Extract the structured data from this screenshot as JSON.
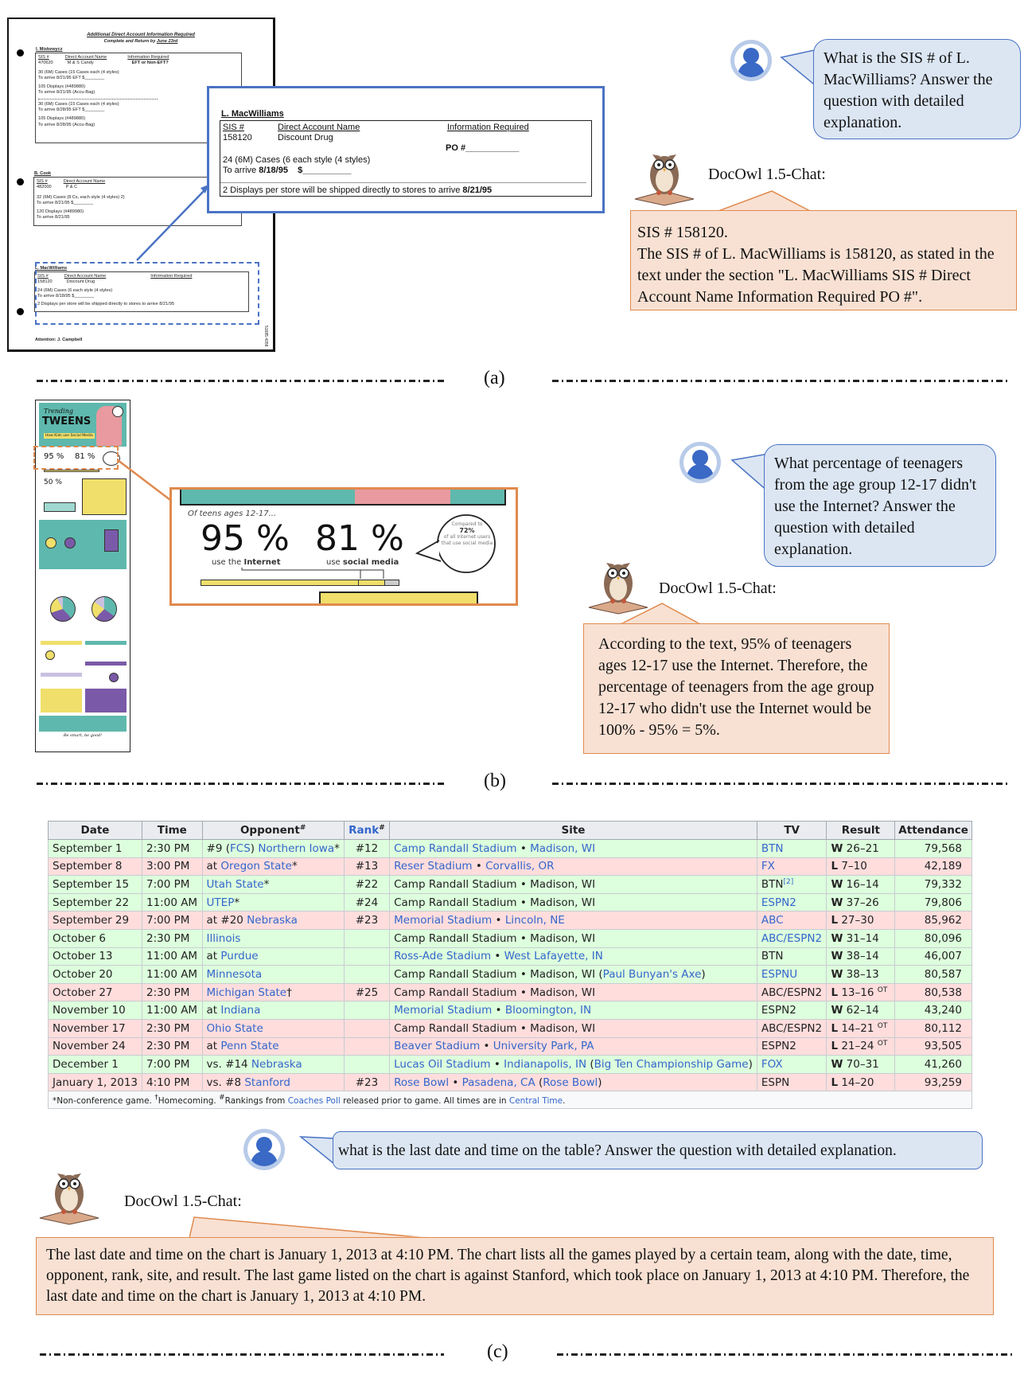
{
  "panels": {
    "a": {
      "label": "(a)",
      "document": {
        "title": "Additional Direct Account Information Required",
        "subtitle_prefix": "Complete and Return by ",
        "subtitle_date": "June 23rd",
        "col_sis": "SIS #",
        "col_account": "Direct Account Name",
        "col_info": "Information Required",
        "accounts": [
          {
            "name": "I. Miskewycz",
            "sis": "470620",
            "account": "M & S Candy",
            "info": "EFT or Non-EFT?",
            "lines": [
              "30 (6M) Cases (15 Cases each (4 styles)",
              "To arrive 8/21/95   EFT $________",
              "105 Displays  (#489880)",
              "To arrive 8/21/95 (Accu-Bag)",
              "30 (6M) Cases (15 Cases each (4 styles)",
              "To arrive 8/28/95   EFT $________",
              "105 Displays  (#489880)",
              "To arrive 8/28/95 (Accu-Bag)"
            ]
          },
          {
            "name": "B. Cook",
            "sis": "482000",
            "account": "P & C",
            "po": "PO #",
            "lines": [
              "32 (6M) Cases (8 Cs, each style (4 styles) 2)",
              "To arrive 8/21/95   $________",
              "120 Displays (#489980)",
              "To arrive 8/21/95"
            ]
          },
          {
            "name": "L. MacWilliams",
            "sis": "158120",
            "account": "Discount Drug",
            "po": "PO #",
            "lines": [
              "24 (6M) Cases (6 each style (4 styles)",
              "To arrive 8/18/95   $________",
              "2 Displays per store will be shipped directly to stores to arrive 8/21/95"
            ]
          }
        ],
        "attention": "Attention:  J. Campbell",
        "stamp": "51685 4058"
      },
      "zoom": {
        "name": "L. MacWilliams",
        "sis_label": "SIS #",
        "sis": "158120",
        "account_label": "Direct Account Name",
        "account": "Discount Drug",
        "info_label": "Information Required",
        "po": "PO #___________",
        "cases": "24 (6M) Cases (6 each style (4 styles)",
        "arrive_prefix": "To arrive ",
        "arrive_date": "8/18/95",
        "arrive_suffix": "    $__________",
        "displays_prefix": "2 Displays per store will be shipped directly to stores to arrive ",
        "displays_date": "8/21/95"
      },
      "question": "What is the SIS # of L. MacWilliams? Answer the question with detailed explanation.",
      "bot_name": "DocOwl 1.5-Chat:",
      "answer_line1": "SIS # 158120.",
      "answer_line2": "The SIS # of L. MacWilliams is 158120, as stated in the text under the section \"L. MacWilliams SIS # Direct Account Name Information Required PO #\"."
    },
    "b": {
      "label": "(b)",
      "infographic": {
        "title_script": "Trending",
        "title": "TWEENS",
        "subtitle": "How Kids use Social Media",
        "stat1": "95 %",
        "stat2": "81 %",
        "stat3": "50 %",
        "footer": "Be smart, be good!"
      },
      "zoom": {
        "intro": "Of teens ages 12-17...",
        "stat1_value": "95 %",
        "stat1_caption_pre": "use the ",
        "stat1_caption_bold": "Internet",
        "stat2_value": "81 %",
        "stat2_caption_pre": "use ",
        "stat2_caption_bold": "social media",
        "bubble_line1": "Compared to",
        "bubble_value": "72%",
        "bubble_line2": "of all Internet users that use social media",
        "bar_internet_fraction": 0.8,
        "bar_social_fraction": 0.93
      },
      "question": "What percentage of teenagers from the age group 12-17 didn't use the Internet? Answer the question with detailed explanation.",
      "bot_name": "DocOwl 1.5-Chat:",
      "answer": "According to the text, 95% of teenagers ages 12-17 use the Internet. Therefore, the percentage of teenagers from the age group 12-17 who didn't use the Internet would be 100% - 95% = 5%."
    },
    "c": {
      "label": "(c)",
      "table": {
        "headers": [
          "Date",
          "Time",
          "Opponent",
          "Rank",
          "Site",
          "TV",
          "Result",
          "Attendance"
        ],
        "header_sup": "#",
        "rows": [
          {
            "outcome": "w",
            "date": "September 1",
            "time": "2:30 PM",
            "opp_pre": "#9 (",
            "opp_link1": "FCS",
            "opp_mid": ") ",
            "opp_link": "Northern Iowa",
            "opp_post": "*",
            "rank": "#12",
            "site_a": "Camp Randall Stadium",
            "site_b": "Madison, WI",
            "site_note": "",
            "site_linked": true,
            "tv": "BTN",
            "tv_linked": true,
            "res": "W",
            "score": "26–21",
            "ot": "",
            "att": "79,568"
          },
          {
            "outcome": "l",
            "date": "September 8",
            "time": "3:00 PM",
            "opp_pre": "at ",
            "opp_link1": "",
            "opp_mid": "",
            "opp_link": "Oregon State",
            "opp_post": "*",
            "rank": "#13",
            "site_a": "Reser Stadium",
            "site_b": "Corvallis, OR",
            "site_note": "",
            "site_linked": true,
            "tv": "FX",
            "tv_linked": true,
            "res": "L",
            "score": "7–10",
            "ot": "",
            "att": "42,189"
          },
          {
            "outcome": "w",
            "date": "September 15",
            "time": "7:00 PM",
            "opp_pre": "",
            "opp_link1": "",
            "opp_mid": "",
            "opp_link": "Utah State",
            "opp_post": "*",
            "rank": "#22",
            "site_a": "Camp Randall Stadium",
            "site_b": "Madison, WI",
            "site_note": "",
            "site_linked": false,
            "tv": "BTN",
            "tv_sup": "[2]",
            "tv_linked": false,
            "res": "W",
            "score": "16–14",
            "ot": "",
            "att": "79,332"
          },
          {
            "outcome": "w",
            "date": "September 22",
            "time": "11:00 AM",
            "opp_pre": "",
            "opp_link1": "",
            "opp_mid": "",
            "opp_link": "UTEP",
            "opp_post": "*",
            "rank": "#24",
            "site_a": "Camp Randall Stadium",
            "site_b": "Madison, WI",
            "site_note": "",
            "site_linked": false,
            "tv": "ESPN2",
            "tv_linked": true,
            "res": "W",
            "score": "37–26",
            "ot": "",
            "att": "79,806"
          },
          {
            "outcome": "l",
            "date": "September 29",
            "time": "7:00 PM",
            "opp_pre": "at #20 ",
            "opp_link1": "",
            "opp_mid": "",
            "opp_link": "Nebraska",
            "opp_post": "",
            "rank": "#23",
            "site_a": "Memorial Stadium",
            "site_b": "Lincoln, NE",
            "site_note": "",
            "site_linked": true,
            "tv": "ABC",
            "tv_linked": true,
            "res": "L",
            "score": "27–30",
            "ot": "",
            "att": "85,962"
          },
          {
            "outcome": "w",
            "date": "October 6",
            "time": "2:30 PM",
            "opp_pre": "",
            "opp_link1": "",
            "opp_mid": "",
            "opp_link": "Illinois",
            "opp_post": "",
            "rank": "",
            "site_a": "Camp Randall Stadium",
            "site_b": "Madison, WI",
            "site_note": "",
            "site_linked": false,
            "tv": "ABC/ESPN2",
            "tv_linked": true,
            "res": "W",
            "score": "31–14",
            "ot": "",
            "att": "80,096"
          },
          {
            "outcome": "w",
            "date": "October 13",
            "time": "11:00 AM",
            "opp_pre": "at ",
            "opp_link1": "",
            "opp_mid": "",
            "opp_link": "Purdue",
            "opp_post": "",
            "rank": "",
            "site_a": "Ross-Ade Stadium",
            "site_b": "West Lafayette, IN",
            "site_note": "",
            "site_linked": true,
            "tv": "BTN",
            "tv_linked": false,
            "res": "W",
            "score": "38–14",
            "ot": "",
            "att": "46,007"
          },
          {
            "outcome": "w",
            "date": "October 20",
            "time": "11:00 AM",
            "opp_pre": "",
            "opp_link1": "",
            "opp_mid": "",
            "opp_link": "Minnesota",
            "opp_post": "",
            "rank": "",
            "site_a": "Camp Randall Stadium",
            "site_b": "Madison, WI",
            "site_note": "Paul Bunyan's Axe",
            "site_linked": false,
            "tv": "ESPNU",
            "tv_linked": true,
            "res": "W",
            "score": "38–13",
            "ot": "",
            "att": "80,587"
          },
          {
            "outcome": "l",
            "date": "October 27",
            "time": "2:30 PM",
            "opp_pre": "",
            "opp_link1": "",
            "opp_mid": "",
            "opp_link": "Michigan State",
            "opp_post": "†",
            "rank": "#25",
            "site_a": "Camp Randall Stadium",
            "site_b": "Madison, WI",
            "site_note": "",
            "site_linked": false,
            "tv": "ABC/ESPN2",
            "tv_linked": false,
            "res": "L",
            "score": "13–16",
            "ot": "OT",
            "att": "80,538"
          },
          {
            "outcome": "w",
            "date": "November 10",
            "time": "11:00 AM",
            "opp_pre": "at ",
            "opp_link1": "",
            "opp_mid": "",
            "opp_link": "Indiana",
            "opp_post": "",
            "rank": "",
            "site_a": "Memorial Stadium",
            "site_b": "Bloomington, IN",
            "site_note": "",
            "site_linked": true,
            "tv": "ESPN2",
            "tv_linked": false,
            "res": "W",
            "score": "62–14",
            "ot": "",
            "att": "43,240"
          },
          {
            "outcome": "l",
            "date": "November 17",
            "time": "2:30 PM",
            "opp_pre": "",
            "opp_link1": "",
            "opp_mid": "",
            "opp_link": "Ohio State",
            "opp_post": "",
            "rank": "",
            "site_a": "Camp Randall Stadium",
            "site_b": "Madison, WI",
            "site_note": "",
            "site_linked": false,
            "tv": "ABC/ESPN2",
            "tv_linked": false,
            "res": "L",
            "score": "14–21",
            "ot": "OT",
            "att": "80,112"
          },
          {
            "outcome": "l",
            "date": "November 24",
            "time": "2:30 PM",
            "opp_pre": "at ",
            "opp_link1": "",
            "opp_mid": "",
            "opp_link": "Penn State",
            "opp_post": "",
            "rank": "",
            "site_a": "Beaver Stadium",
            "site_b": "University Park, PA",
            "site_note": "",
            "site_linked": true,
            "tv": "ESPN2",
            "tv_linked": false,
            "res": "L",
            "score": "21–24",
            "ot": "OT",
            "att": "93,505"
          },
          {
            "outcome": "w",
            "date": "December 1",
            "time": "7:00 PM",
            "opp_pre": "vs. #14 ",
            "opp_link1": "",
            "opp_mid": "",
            "opp_link": "Nebraska",
            "opp_post": "",
            "rank": "",
            "site_a": "Lucas Oil Stadium",
            "site_b": "Indianapolis, IN",
            "site_note": "Big Ten Championship Game",
            "site_linked": true,
            "tv": "FOX",
            "tv_linked": true,
            "res": "W",
            "score": "70–31",
            "ot": "",
            "att": "41,260"
          },
          {
            "outcome": "l",
            "date": "January 1, 2013",
            "time": "4:10 PM",
            "opp_pre": "vs. #8 ",
            "opp_link1": "",
            "opp_mid": "",
            "opp_link": "Stanford",
            "opp_post": "",
            "rank": "#23",
            "site_a": "Rose Bowl",
            "site_b": "Pasadena, CA",
            "site_note": "Rose Bowl",
            "site_linked": true,
            "tv": "ESPN",
            "tv_linked": false,
            "res": "L",
            "score": "14–20",
            "ot": "",
            "att": "93,259"
          }
        ],
        "footnote": {
          "part1": "*Non-conference game. ",
          "dagger": "†",
          "part2": "Homecoming. ",
          "hash": "#",
          "part3": "Rankings from ",
          "link1": "Coaches Poll",
          "part4": " released prior to game. All times are in ",
          "link2": "Central Time",
          "part5": "."
        }
      },
      "question": "what is the last date and time on the table? Answer the question with detailed explanation.",
      "bot_name": "DocOwl 1.5-Chat:",
      "answer": "The last date and time on the chart is January 1, 2013 at 4:10 PM. The chart lists all the games played by a certain team, along with the date, time, opponent, rank, site, and result. The last game listed on the chart is against Stanford, which took place on January 1, 2013 at 4:10 PM. Therefore, the last date and time on the chart is January 1, 2013 at 4:10 PM."
    }
  },
  "colors": {
    "question_fill": "#dce6f3",
    "question_border": "#4a73c4",
    "answer_fill": "#f8e1d3",
    "answer_border": "#e08a4e",
    "win_row": "#ddffdd",
    "loss_row": "#ffdddd",
    "link": "#3366cc"
  }
}
